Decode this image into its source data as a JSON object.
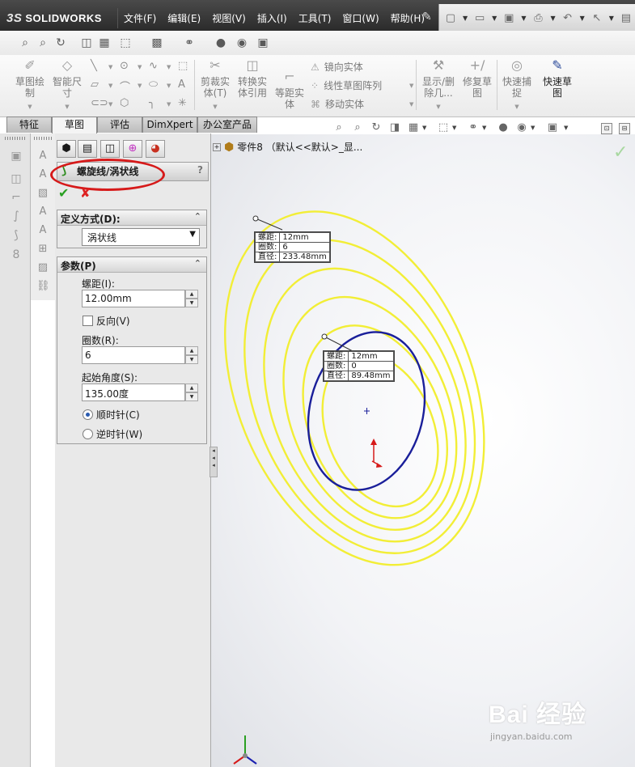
{
  "app": {
    "logo_prefix": "3S",
    "logo_text": "SOLIDWORKS"
  },
  "menu": [
    "文件(F)",
    "编辑(E)",
    "视图(V)",
    "插入(I)",
    "工具(T)",
    "窗口(W)",
    "帮助(H)"
  ],
  "command_manager": {
    "sketch": "草图绘制",
    "smart_dimension": "智能尺寸",
    "trim": "剪裁实体(T)",
    "convert": "转换实体引用",
    "offset": "等距实体",
    "mirror": "镜向实体",
    "linear_pattern": "线性草图阵列",
    "move": "移动实体",
    "show_delete": "显示/删除几...",
    "repair": "修复草图",
    "quick_snaps": "快速捕捉",
    "rapid_sketch": "快速草图"
  },
  "tabs": [
    "特征",
    "草图",
    "评估",
    "DimXpert",
    "办公室产品"
  ],
  "active_tab": "草图",
  "feature_tree": {
    "item": "零件8 （默认<<默认>_显..."
  },
  "property_manager": {
    "title": "螺旋线/涡状线",
    "help": "?",
    "define_by": {
      "header": "定义方式(D):",
      "value": "涡状线"
    },
    "parameters": {
      "header": "参数(P)",
      "pitch_label": "螺距(I):",
      "pitch_value": "12.00mm",
      "reverse_label": "反向(V)",
      "reverse_checked": false,
      "revolutions_label": "圈数(R):",
      "revolutions_value": "6",
      "start_angle_label": "起始角度(S):",
      "start_angle_value": "135.00度",
      "clockwise_label": "顺时针(C)",
      "counterclockwise_label": "逆时针(W)",
      "direction": "clockwise"
    }
  },
  "callouts": {
    "outer": {
      "pitch_label": "螺距:",
      "pitch": "12mm",
      "rev_label": "圈数:",
      "revs": "6",
      "dia_label": "直径:",
      "dia": "233.48mm"
    },
    "inner": {
      "pitch_label": "螺距:",
      "pitch": "12mm",
      "rev_label": "圈数:",
      "revs": "0",
      "dia_label": "直径:",
      "dia": "89.48mm"
    }
  },
  "watermark": {
    "brand": "Bai 经验",
    "url": "jingyan.baidu.com"
  },
  "colors": {
    "spiral": "#f2ee36",
    "profile": "#1a1f9a",
    "highlight": "#d61a1a",
    "accept": "#2aa022"
  }
}
